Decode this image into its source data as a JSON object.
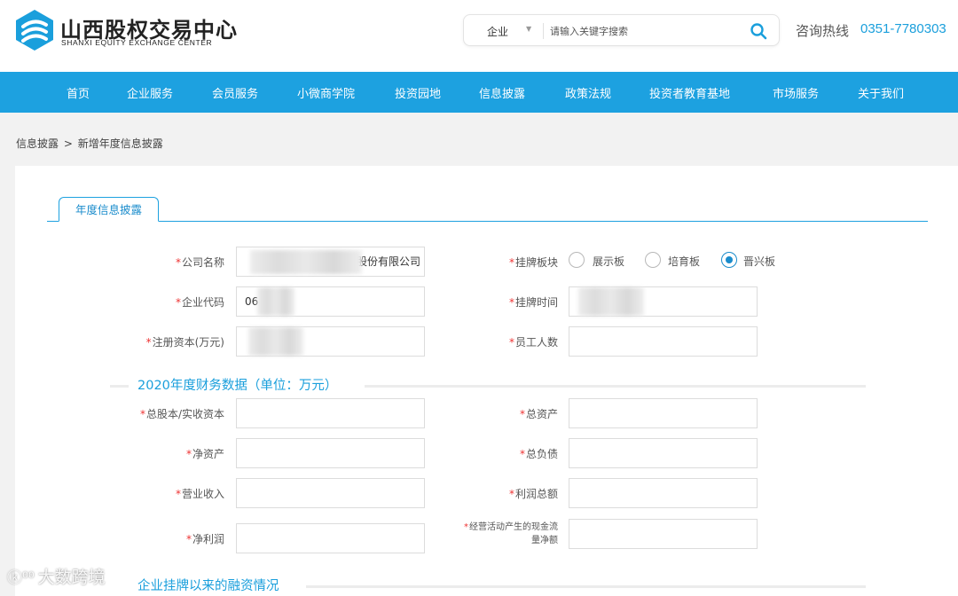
{
  "header": {
    "logo_cn": "山西股权交易中心",
    "logo_en": "SHANXI EQUITY EXCHANGE CENTER",
    "search_category": "企业",
    "search_placeholder": "请输入关键字搜索",
    "hotline_label": "咨询热线",
    "hotline_number": "0351-7780303"
  },
  "nav": {
    "items": [
      "首页",
      "企业服务",
      "会员服务",
      "小微商学院",
      "投资园地",
      "信息披露",
      "政策法规",
      "投资者教育基地",
      "市场服务",
      "关于我们"
    ]
  },
  "breadcrumb": {
    "parent": "信息披露",
    "separator": ">",
    "current": "新增年度信息披露"
  },
  "tab": {
    "label": "年度信息披露"
  },
  "basic_info": {
    "company_name_label": "公司名称",
    "company_name_value": "股份有限公司",
    "company_code_label": "企业代码",
    "company_code_value": "06",
    "registered_capital_label": "注册资本(万元)",
    "board_label": "挂牌板块",
    "board_options": [
      "展示板",
      "培育板",
      "晋兴板"
    ],
    "board_selected": "晋兴板",
    "listing_time_label": "挂牌时间",
    "employees_label": "员工人数"
  },
  "financial": {
    "section_title": "2020年度财务数据（单位：万元）",
    "share_capital_label": "总股本/实收资本",
    "total_assets_label": "总资产",
    "net_assets_label": "净资产",
    "total_liabilities_label": "总负债",
    "revenue_label": "营业收入",
    "total_profit_label": "利润总额",
    "net_profit_label": "净利润",
    "operating_cashflow_label_line1": "经营活动产生的现金流",
    "operating_cashflow_label_line2": "量净额"
  },
  "financing": {
    "section_title": "企业挂牌以来的融资情况"
  },
  "watermark": {
    "text": "大数跨境"
  },
  "colors": {
    "brand_blue": "#1da1e0",
    "required_red": "#e33333"
  }
}
